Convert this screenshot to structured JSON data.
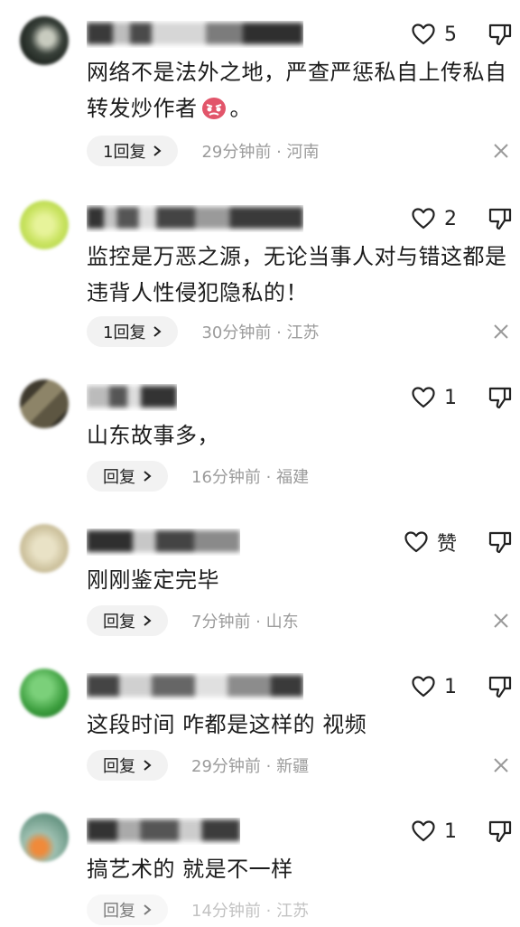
{
  "colors": {
    "text": "#1c1c1c",
    "secondary": "#9b9b9b",
    "reply_bg": "#f2f2f2",
    "icon": "#222222"
  },
  "icons": {
    "like": "heart-outline",
    "dislike": "thumbs-down-outline",
    "reply_arrow": "chevron-right",
    "close": "x-mark",
    "emoji": "angry-face"
  },
  "comments": [
    {
      "username": "身安i…0138",
      "likes": "5",
      "text": "网络不是法外之地，严查严惩私自上传私自转发炒作者",
      "text_tail": "。",
      "reply_label": "1回复",
      "meta": "29分钟前 · 河南"
    },
    {
      "username": "生活有道…",
      "likes": "2",
      "text": "监控是万恶之源，无论当事人对与错这都是违背人性侵犯隐私的！",
      "reply_label": "1回复",
      "meta": "30分钟前 · 江苏"
    },
    {
      "username": "…",
      "likes": "1",
      "text": "山东故事多，",
      "reply_label": "回复",
      "meta": "16分钟前 · 福建"
    },
    {
      "username": "水陆…",
      "likes": "赞",
      "text": "刚刚鉴定完毕",
      "reply_label": "回复",
      "meta": "7分钟前 · 山东"
    },
    {
      "username": "…",
      "likes": "1",
      "text": "这段时间 咋都是这样的 视频",
      "reply_label": "回复",
      "meta": "29分钟前 · 新疆"
    },
    {
      "username": "…778",
      "likes": "1",
      "text": "搞艺术的 就是不一样",
      "reply_label": "回复",
      "meta": "14分钟前 · 江苏"
    }
  ]
}
